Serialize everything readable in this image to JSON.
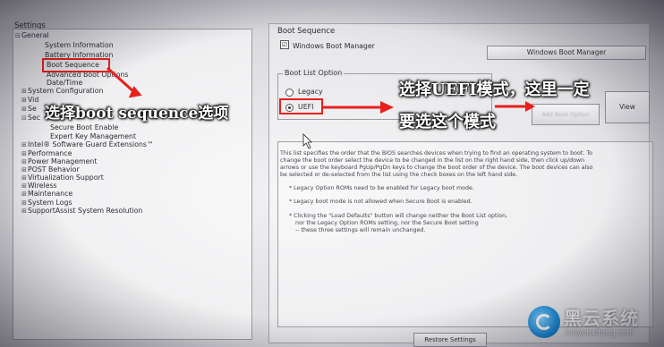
{
  "tree": {
    "title": "Settings",
    "items": [
      {
        "label": "General",
        "expander": "⊟"
      },
      {
        "label": "System Information",
        "expander": ""
      },
      {
        "label": "Battery Information",
        "expander": ""
      },
      {
        "label": "Boot Sequence",
        "expander": ""
      },
      {
        "label": "Advanced Boot Options",
        "expander": ""
      },
      {
        "label": "Date/Time",
        "expander": ""
      },
      {
        "label": "System Configuration",
        "expander": "⊞"
      },
      {
        "label": "Vid",
        "expander": "⊞"
      },
      {
        "label": "Se",
        "expander": "⊞"
      },
      {
        "label": "Sec",
        "expander": "⊟"
      },
      {
        "label": "Secure Boot Enable",
        "expander": ""
      },
      {
        "label": "Expert Key Management",
        "expander": ""
      },
      {
        "label": "Intel® Software Guard Extensions™",
        "expander": "⊞"
      },
      {
        "label": "Performance",
        "expander": "⊞"
      },
      {
        "label": "Power Management",
        "expander": "⊞"
      },
      {
        "label": "POST Behavior",
        "expander": "⊞"
      },
      {
        "label": "Virtualization Support",
        "expander": "⊞"
      },
      {
        "label": "Wireless",
        "expander": "⊞"
      },
      {
        "label": "Maintenance",
        "expander": "⊞"
      },
      {
        "label": "System Logs",
        "expander": "⊞"
      },
      {
        "label": "SupportAssist System Resolution",
        "expander": "⊞"
      }
    ]
  },
  "boot_sequence": {
    "title": "Boot Sequence",
    "entry_checkbox_mark": "☑",
    "entry_label": "Windows Boot Manager",
    "list_item": "Windows Boot Manager"
  },
  "boot_list_option": {
    "title": "Boot List Option",
    "legacy_label": "Legacy",
    "uefi_label": "UEFI",
    "selected": "UEFI"
  },
  "buttons": {
    "add_boot_option": "Add Boot Option",
    "view": "View",
    "restore_settings": "Restore Settings"
  },
  "help": {
    "lines": [
      "This list specifies the order that the BIOS searches devices when trying to find an operating system to boot. To",
      "change the boot order select the device to be changed in the list on the right hand side, then click up/down",
      "arrows or use the keyboard PgUp/PgDn keys to change the boot order of the device. The boot devices can also",
      "be selected or de-selected from the list using the check boxes on the left hand side.",
      "* Legacy Option ROMs need to be enabled for Legacy boot mode.",
      "* Legacy boot mode is not allowed when Secure Boot is enabled.",
      "* Clicking the \"Load Defaults\" button will change neither the Boot List option,",
      "nor the Legacy Option ROMs setting, nor the Secure Boot setting",
      "-- these three settings will remain unchanged."
    ]
  },
  "annotations": {
    "left_callout": "选择boot sequence选项",
    "right_callout_line1": "选择UEFI模式，这里一定",
    "right_callout_line2": "要选这个模式"
  },
  "watermark": {
    "title": "黑云系统",
    "url": "heiyunxitong.com"
  },
  "colors": {
    "annotation_red": "#e8201d",
    "watermark_blue": "#1a8ad8"
  }
}
